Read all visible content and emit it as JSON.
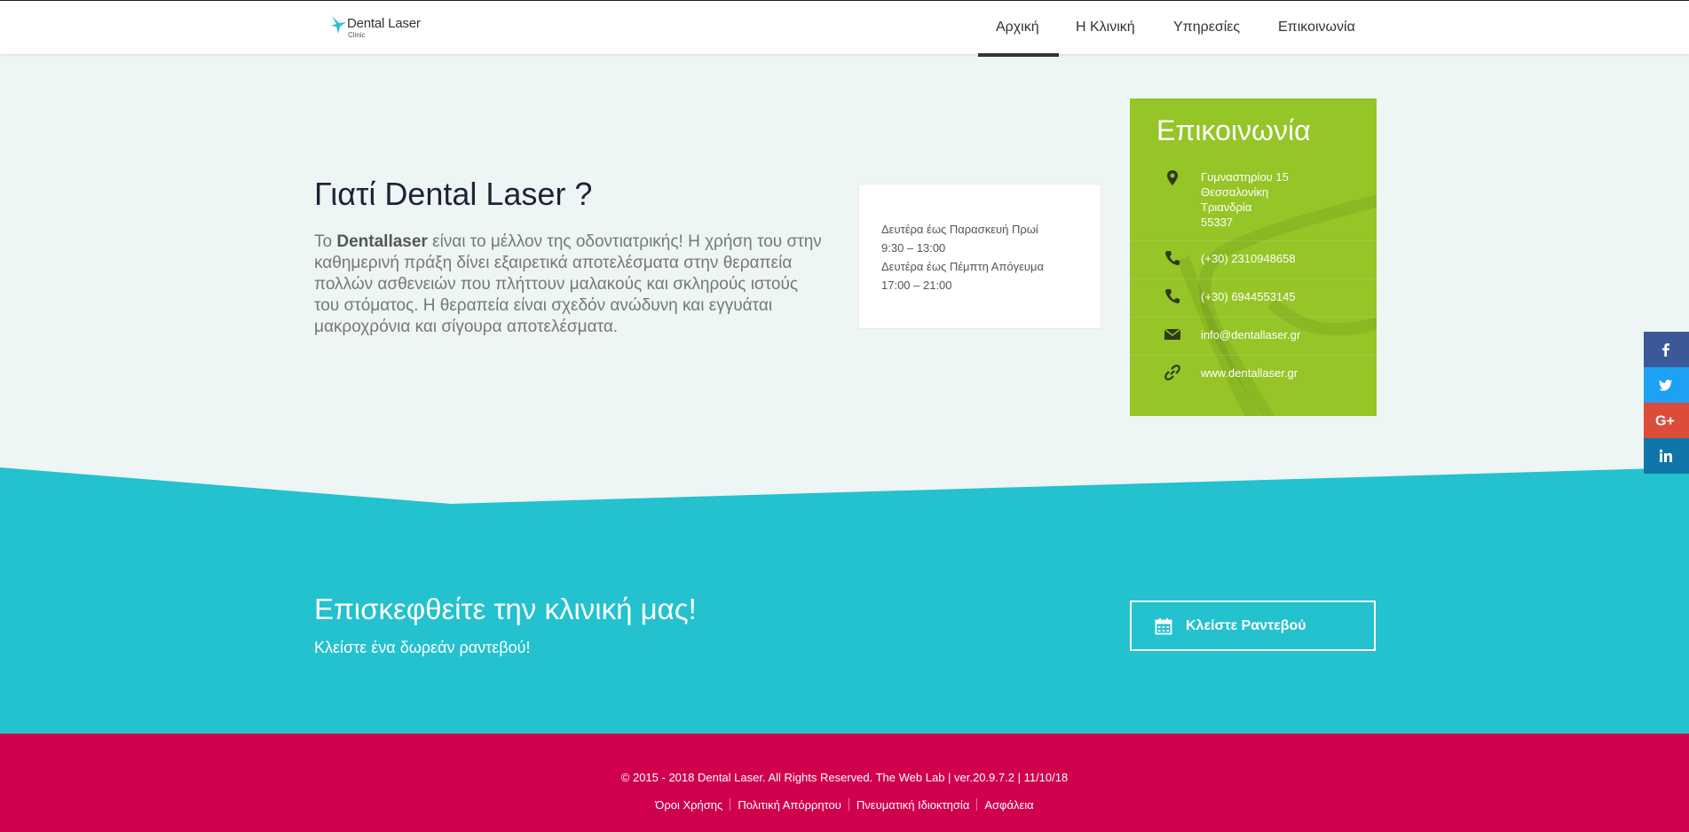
{
  "colors": {
    "green": "#95c527",
    "teal": "#24c1cf",
    "footer": "#d0004f",
    "intro_bg": "#eef6f5"
  },
  "header": {
    "logo_title": "Dental Laser",
    "logo_subtitle": "Clinic",
    "nav": [
      "Αρχική",
      "Η Κλινική",
      "Υπηρεσίες",
      "Επικοινωνία"
    ],
    "active_nav": "Αρχική"
  },
  "intro": {
    "title": "Γιατί Dental Laser ?",
    "text_prefix": "Το ",
    "text_bold": "Dentallaser",
    "text_rest": " είναι το μέλλον της οδοντιατρικής! Η χρήση του στην καθημερινή πράξη δίνει εξαιρετικά αποτελέσματα στην θεραπεία πολλών ασθενειών που πλήττουν μαλακούς και σκληρούς ιστούς του στόματος. Η θεραπεία είναι σχεδόν ανώδυνη και εγγυάται μακροχρόνια και σίγουρα αποτελέσματα."
  },
  "hours": {
    "line1": "Δευτέρα έως Παρασκευή Πρωί",
    "line2": "9:30 – 13:00",
    "line3": "Δευτέρα έως Πέμπτη Απόγευμα",
    "line4": "17:00 – 21:00"
  },
  "contact": {
    "title": "Επικοινωνία",
    "address": [
      "Γυμναστηρίου 15",
      "Θεσσαλονίκη",
      "Τριανδρία",
      "55337"
    ],
    "phone1": "(+30) 2310948658",
    "phone2": "(+30) 6944553145",
    "email": "info@dentallaser.gr",
    "website": "www.dentallaser.gr",
    "icons": [
      "map-marker-icon",
      "phone-icon",
      "phone-icon",
      "envelope-icon",
      "link-icon"
    ]
  },
  "cta": {
    "title": "Επισκεφθείτε την κλινική μας!",
    "subtitle": "Κλείστε ένα δωρεάν ραντεβού!",
    "button": "Κλείστε Ραντεβού"
  },
  "footer": {
    "copyright": "© 2015 - 2018 Dental Laser. All Rights Reserved. The Web Lab | ver.20.9.7.2 | 11/10/18",
    "links": [
      "Όροι Χρήσης",
      "Πολιτική Απόρρητου",
      "Πνευματική Ιδιοκτησία",
      "Ασφάλεια"
    ]
  },
  "social": [
    {
      "name": "facebook-icon",
      "color": "#3b5998"
    },
    {
      "name": "twitter-icon",
      "color": "#1da1f2"
    },
    {
      "name": "google-plus-icon",
      "color": "#dd4b39"
    },
    {
      "name": "linkedin-icon",
      "color": "#0e76a8"
    }
  ]
}
